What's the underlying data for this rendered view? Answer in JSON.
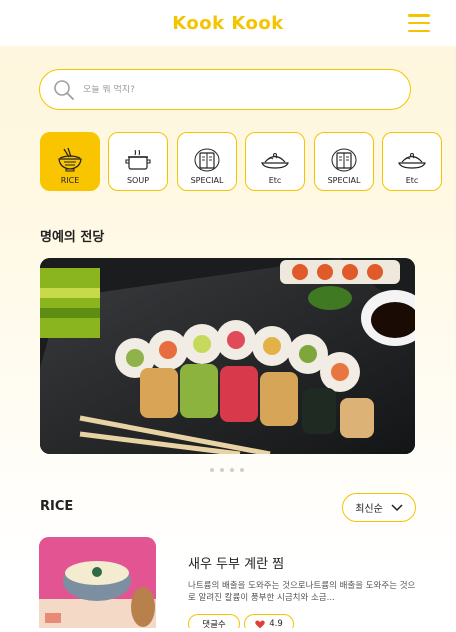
{
  "header": {
    "logo": "Kook Kook",
    "menu_icon": "hamburger-menu-icon"
  },
  "search": {
    "placeholder": "오늘 뭐 먹지?",
    "icon": "search-icon"
  },
  "categories": [
    {
      "label": "RICE",
      "icon": "rice-bowl-icon",
      "active": true
    },
    {
      "label": "SOUP",
      "icon": "soup-pot-icon",
      "active": false
    },
    {
      "label": "SPECIAL",
      "icon": "recipe-book-icon",
      "active": false
    },
    {
      "label": "Etc",
      "icon": "covered-dish-icon",
      "active": false
    },
    {
      "label": "SPECIAL",
      "icon": "recipe-book-icon",
      "active": false
    },
    {
      "label": "Etc",
      "icon": "covered-dish-icon",
      "active": false
    }
  ],
  "hall_of_fame": {
    "title": "명예의 전당",
    "carousel_dots": 4
  },
  "rice_section": {
    "title": "RICE",
    "sort_label": "최신순",
    "card": {
      "title": "새우 두부 계란 찜",
      "description": "나트륨의 배출을 도와주는 것으로나트륨의 배출을 도와주는 것으로 알려진 칼륨이 풍부한 시금치와 소금...",
      "comment_label": "댓글수",
      "rating": "4.9"
    }
  },
  "colors": {
    "accent": "#f5c400",
    "active_category": "#f9c500",
    "background": "#fff8e3"
  }
}
